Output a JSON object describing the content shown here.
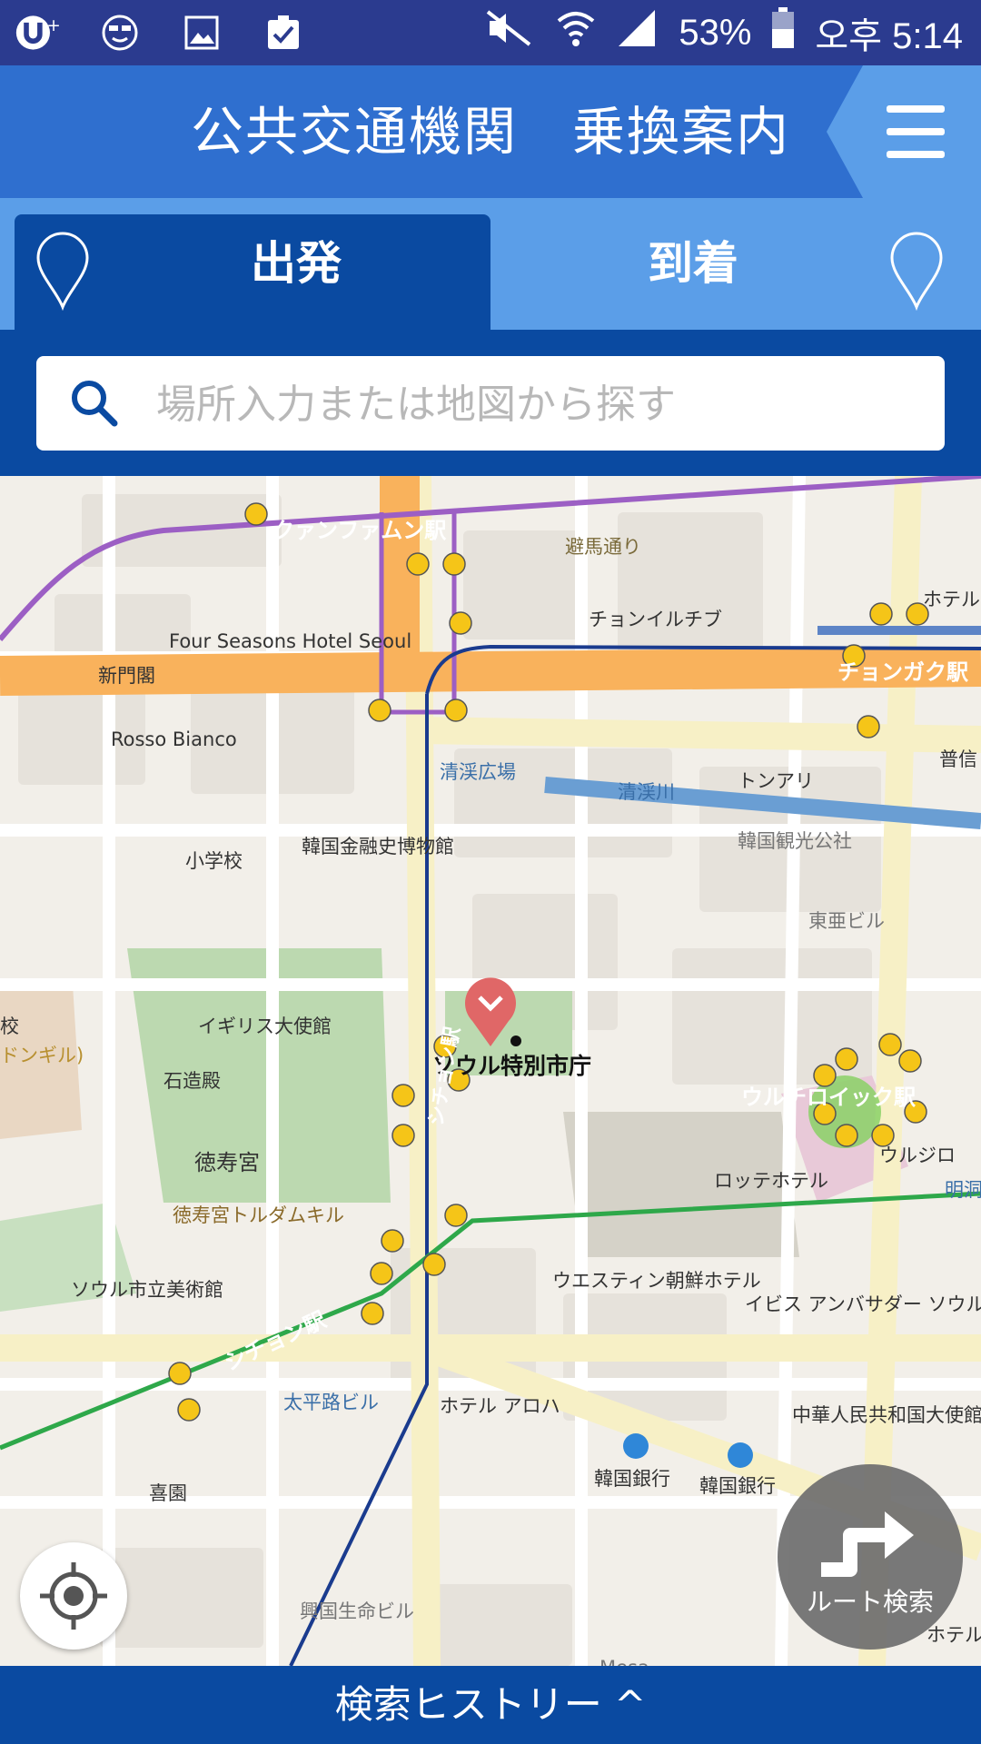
{
  "status_bar": {
    "battery": "53%",
    "time": "오후 5:14",
    "icons": [
      "uplus-icon",
      "face-icon",
      "image-icon",
      "clipboard-check-icon",
      "mute-icon",
      "wifi-icon",
      "signal-icon",
      "battery-icon"
    ]
  },
  "header": {
    "title": "公共交通機関　乗換案内",
    "menu_icon": "hamburger-icon"
  },
  "tabs": {
    "depart": "出発",
    "arrive": "到着"
  },
  "search": {
    "placeholder": "場所入力または地図から探す"
  },
  "map": {
    "labels": {
      "gwanghwamun_station": "クァンファムン駅",
      "pimatong": "避馬通り",
      "restaurant1": "チョンイルチブ",
      "hotel_top": "ホテル",
      "four_seasons": "Four Seasons Hotel Seoul",
      "sinmun": "新門閣",
      "jonggak_station": "チョンガク駅",
      "bosin": "普信",
      "rosso": "Rosso Bianco",
      "cheonggye_plaza": "清渓広場",
      "cheonggyecheon": "清渓川",
      "tonari": "トンアリ",
      "finance_museum": "韓国金融史博物館",
      "tourism": "韓国観光公社",
      "school": "小学校",
      "dongah": "東亜ビル",
      "uk_embassy": "イギリス大使館",
      "gyo": "校",
      "dongil": "ドンギル)",
      "city_hall": "ソウル特別市庁",
      "seokjojeon": "石造殿",
      "deoksugung": "徳寿宮",
      "euljiro_station": "ウルチロイック駅",
      "euljiro": "ウルジロ",
      "myeong": "明洞",
      "sicheong_station_v": "シチョン駅",
      "lotte": "ロッテホテル",
      "doldam": "徳寿宮トルダムキル",
      "art_museum": "ソウル市立美術館",
      "westin": "ウエスティン朝鮮ホテル",
      "ibis": "イビス アンバサダー ソウル",
      "sicheong_station": "シチョン駅",
      "taepyeong": "太平路ビル",
      "aloha": "ホテル アロハ",
      "china_embassy": "中華人民共和国大使館",
      "heeun": "喜園",
      "bok1": "韓国銀行",
      "bok2": "韓国銀行",
      "heungkuk": "興国生命ビル",
      "mesa": "Mesa",
      "hotel_br": "ホテル"
    }
  },
  "buttons": {
    "locate_icon": "crosshair-icon",
    "route_search": "ルート検索",
    "route_icon": "route-arrow-icon"
  },
  "footer": {
    "history": "検索ヒストリー ^"
  }
}
